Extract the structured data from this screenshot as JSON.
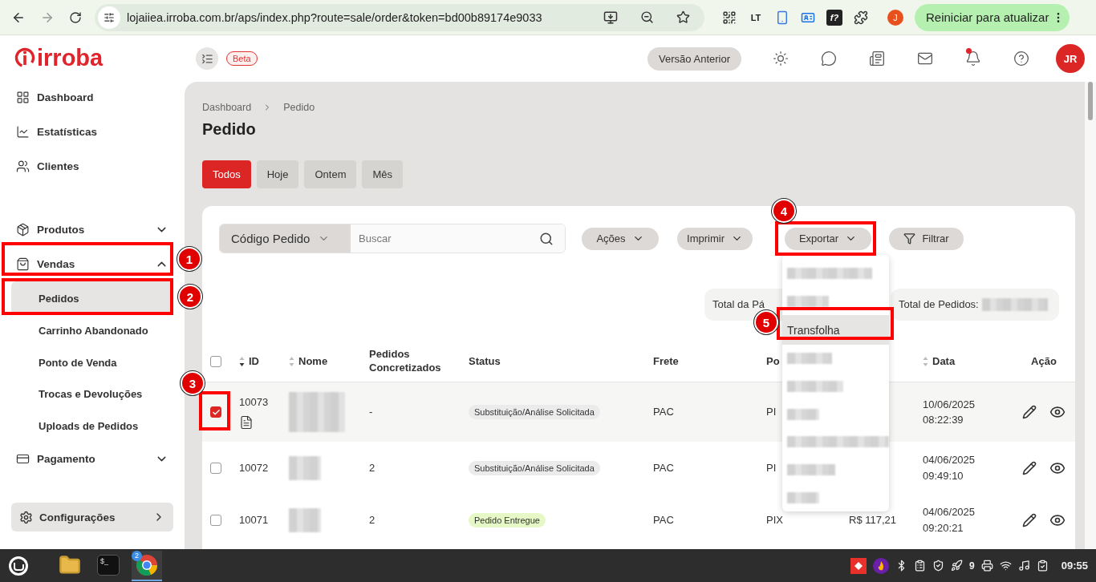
{
  "browser": {
    "url": "lojaiiea.irroba.com.br/aps/index.php?route=sale/order&token=bd00b89174e9033",
    "extensions": [
      {
        "kind": "qr"
      },
      {
        "kind": "text",
        "label": "LT"
      },
      {
        "kind": "phone"
      },
      {
        "kind": "card"
      },
      {
        "kind": "dark",
        "label": "f?"
      },
      {
        "kind": "puzzle"
      }
    ],
    "profile": "J",
    "update_button": "Reiniciar para atualizar"
  },
  "header": {
    "logo": "irroba",
    "badge": "Beta",
    "previous_version": "Versão Anterior",
    "notification_dot": true,
    "avatar": "JR"
  },
  "sidebar": {
    "items": [
      {
        "kind": "link",
        "label": "Dashboard"
      },
      {
        "kind": "link",
        "label": "Estatísticas"
      },
      {
        "kind": "link",
        "label": "Clientes"
      },
      {
        "kind": "group",
        "label": "Produtos",
        "expanded": false
      },
      {
        "kind": "group",
        "label": "Vendas",
        "expanded": true,
        "children": [
          {
            "label": "Pedidos",
            "selected": true
          },
          {
            "label": "Carrinho Abandonado",
            "selected": false
          },
          {
            "label": "Ponto de Venda",
            "selected": false
          },
          {
            "label": "Trocas e Devoluções",
            "selected": false
          },
          {
            "label": "Uploads de Pedidos",
            "selected": false
          }
        ]
      },
      {
        "kind": "group",
        "label": "Pagamento",
        "expanded": false
      }
    ],
    "settings": "Configurações"
  },
  "page": {
    "breadcrumb": [
      "Dashboard",
      "Pedido"
    ],
    "title": "Pedido",
    "filter_tabs": [
      {
        "label": "Todos",
        "selected": true
      },
      {
        "label": "Hoje",
        "selected": false
      },
      {
        "label": "Ontem",
        "selected": false
      },
      {
        "label": "Mês",
        "selected": false
      }
    ],
    "search": {
      "field": "Código Pedido",
      "placeholder": "Buscar"
    },
    "actions": [
      {
        "kind": "menu",
        "label": "Ações"
      },
      {
        "kind": "menu",
        "label": "Imprimir"
      },
      {
        "kind": "menu",
        "label": "Exportar"
      },
      {
        "kind": "filter",
        "label": "Filtrar"
      }
    ],
    "export_menu": [
      {
        "kind": "redacted"
      },
      {
        "kind": "redacted"
      },
      {
        "kind": "text",
        "label": "Transfolha",
        "selected": true
      },
      {
        "kind": "redacted"
      },
      {
        "kind": "redacted"
      },
      {
        "kind": "redacted"
      },
      {
        "kind": "redacted"
      },
      {
        "kind": "redacted"
      },
      {
        "kind": "redacted"
      }
    ],
    "totals": [
      {
        "label": "Total da Pá"
      },
      {
        "label": "Total de Pedidos:",
        "redacted_value": true
      }
    ],
    "table": {
      "select_all_checked": false,
      "columns": [
        {
          "label": "ID",
          "sortable": true,
          "sorted_desc": true
        },
        {
          "label": "Nome",
          "sortable": true,
          "sorted_desc": false
        },
        {
          "label": "Pedidos Concretizados"
        },
        {
          "label": "Status"
        },
        {
          "label": "Frete"
        },
        {
          "label": "Po"
        },
        {},
        {
          "label": "Data",
          "sortable": true,
          "sorted_desc": false
        },
        {
          "label": "Ação"
        }
      ],
      "rows": [
        {
          "selected": true,
          "id": "10073",
          "note": true,
          "orders": "-",
          "status": {
            "label": "Substituição/Análise Solicitada",
            "color": "#ebebeb"
          },
          "shipping": "PAC",
          "payment": "PI",
          "date": "10/06/2025",
          "time": "08:22:39"
        },
        {
          "selected": false,
          "id": "10072",
          "note": false,
          "orders": "2",
          "status": {
            "label": "Substituição/Análise Solicitada",
            "color": "#ebebeb"
          },
          "shipping": "PAC",
          "payment": "PI",
          "date": "04/06/2025",
          "time": "09:49:10"
        },
        {
          "selected": false,
          "id": "10071",
          "note": false,
          "orders": "2",
          "status": {
            "label": "Pedido Entregue",
            "color": "#e6f8c6"
          },
          "shipping": "PAC",
          "payment": "PIX",
          "value": "R$ 117,21",
          "date": "04/06/2025",
          "time": "09:20:21"
        }
      ]
    }
  },
  "annotations": [
    {
      "number": "1"
    },
    {
      "number": "2"
    },
    {
      "number": "3"
    },
    {
      "number": "4"
    },
    {
      "number": "5"
    }
  ],
  "taskbar": {
    "apps": [
      {
        "kind": "folder",
        "active": false
      },
      {
        "kind": "terminal",
        "label": "$_",
        "active": false
      },
      {
        "kind": "chrome",
        "badge": "2",
        "active": true
      }
    ],
    "tray_count": "9",
    "clock": "09:55"
  }
}
